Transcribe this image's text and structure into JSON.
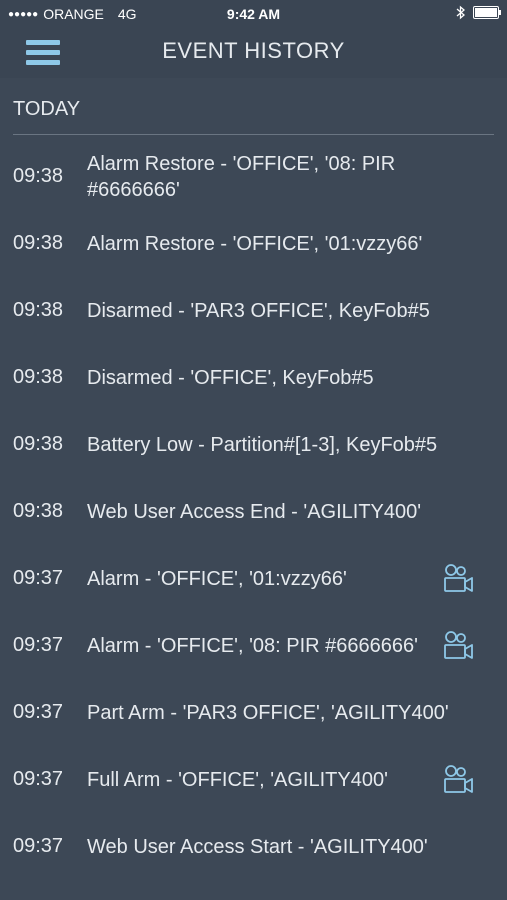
{
  "status_bar": {
    "signal": "●●●●●",
    "carrier": "ORANGE",
    "network": "4G",
    "time": "9:42 AM",
    "bluetooth_icon": "bluetooth-icon",
    "battery_icon": "battery-icon"
  },
  "header": {
    "title": "EVENT HISTORY",
    "menu_icon": "hamburger-menu-icon"
  },
  "section": {
    "label": "TODAY"
  },
  "events": [
    {
      "time": "09:38",
      "description": "Alarm Restore - 'OFFICE', '08: PIR #6666666'",
      "has_camera": false
    },
    {
      "time": "09:38",
      "description": "Alarm Restore - 'OFFICE', '01:vzzy66'",
      "has_camera": false
    },
    {
      "time": "09:38",
      "description": "Disarmed - 'PAR3 OFFICE', KeyFob#5",
      "has_camera": false
    },
    {
      "time": "09:38",
      "description": "Disarmed - 'OFFICE', KeyFob#5",
      "has_camera": false
    },
    {
      "time": "09:38",
      "description": "Battery Low - Partition#[1-3], KeyFob#5",
      "has_camera": false
    },
    {
      "time": "09:38",
      "description": "Web User Access End - 'AGILITY400'",
      "has_camera": false
    },
    {
      "time": "09:37",
      "description": "Alarm - 'OFFICE', '01:vzzy66'",
      "has_camera": true
    },
    {
      "time": "09:37",
      "description": "Alarm - 'OFFICE', '08: PIR #6666666'",
      "has_camera": true
    },
    {
      "time": "09:37",
      "description": "Part Arm - 'PAR3 OFFICE', 'AGILITY400'",
      "has_camera": false
    },
    {
      "time": "09:37",
      "description": "Full Arm - 'OFFICE', 'AGILITY400'",
      "has_camera": true
    },
    {
      "time": "09:37",
      "description": "Web User Access Start - 'AGILITY400'",
      "has_camera": false
    }
  ],
  "colors": {
    "background": "#3d4856",
    "header_background": "#3a4553",
    "accent": "#8ec8e8",
    "text": "#e6eaee"
  }
}
